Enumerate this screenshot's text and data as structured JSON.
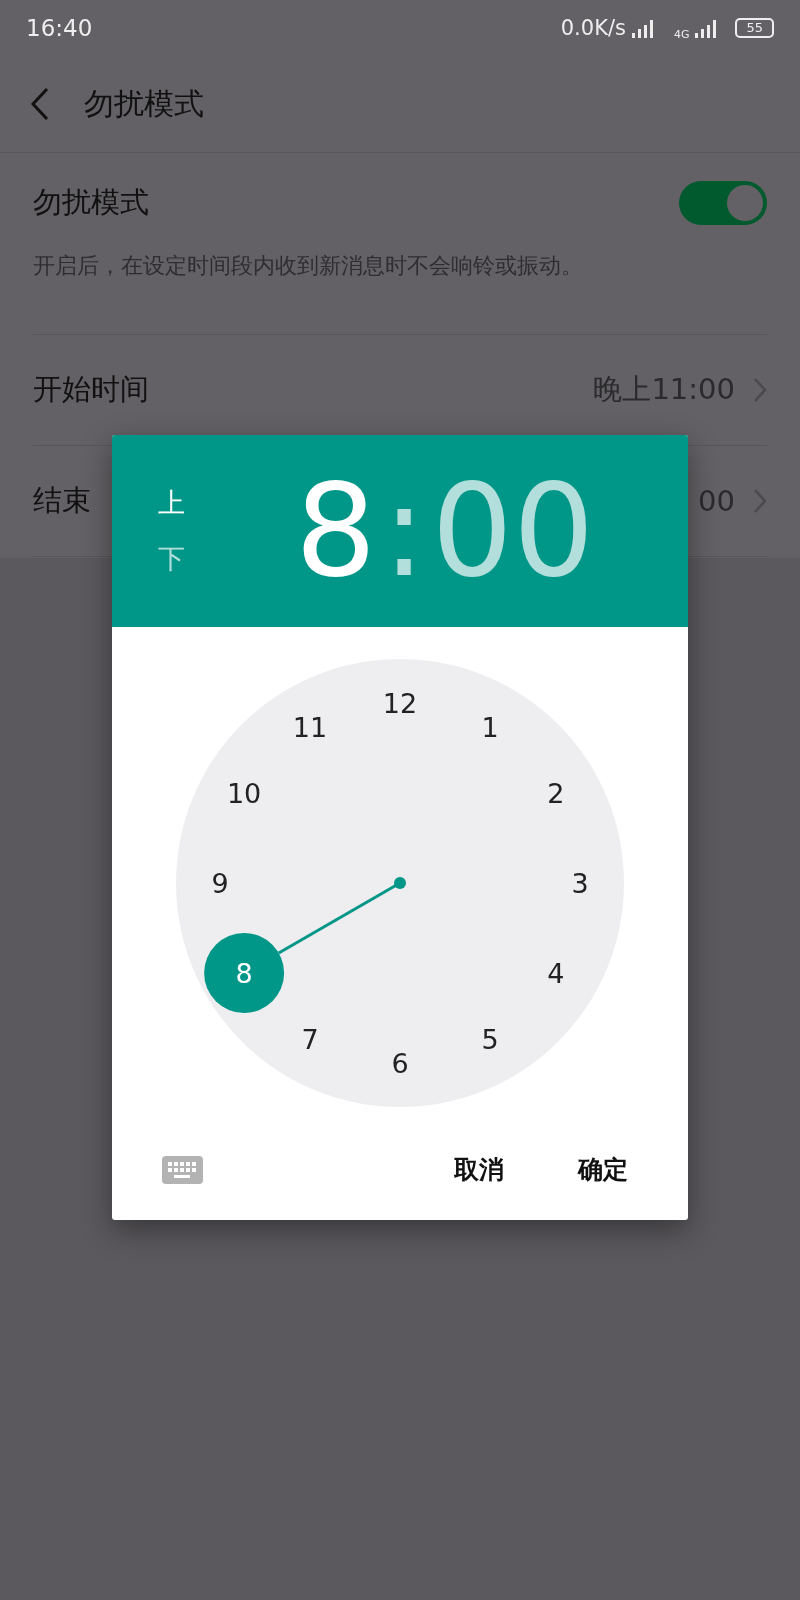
{
  "status_bar": {
    "time": "16:40",
    "net_speed": "0.0K/s",
    "network": "4G",
    "battery": "55"
  },
  "header": {
    "title": "勿扰模式"
  },
  "dnd": {
    "title": "勿扰模式",
    "description": "开启后，在设定时间段内收到新消息时不会响铃或振动。",
    "on": true
  },
  "rows": [
    {
      "label": "开始时间",
      "value": "晚上11:00"
    },
    {
      "label": "结束",
      "value": "00"
    }
  ],
  "dialog": {
    "meridiem": [
      {
        "label": "上",
        "selected": true
      },
      {
        "label": "下",
        "selected": false
      }
    ],
    "hour": "8",
    "separator": ":",
    "minute": "00",
    "hour_selected": true,
    "clock_numbers": [
      {
        "label": "12",
        "selected": false
      },
      {
        "label": "1",
        "selected": false
      },
      {
        "label": "2",
        "selected": false
      },
      {
        "label": "3",
        "selected": false
      },
      {
        "label": "4",
        "selected": false
      },
      {
        "label": "5",
        "selected": false
      },
      {
        "label": "6",
        "selected": false
      },
      {
        "label": "7",
        "selected": false
      },
      {
        "label": "8",
        "selected": true
      },
      {
        "label": "9",
        "selected": false
      },
      {
        "label": "10",
        "selected": false
      },
      {
        "label": "11",
        "selected": false
      }
    ],
    "buttons": [
      "取消",
      "确定"
    ]
  }
}
